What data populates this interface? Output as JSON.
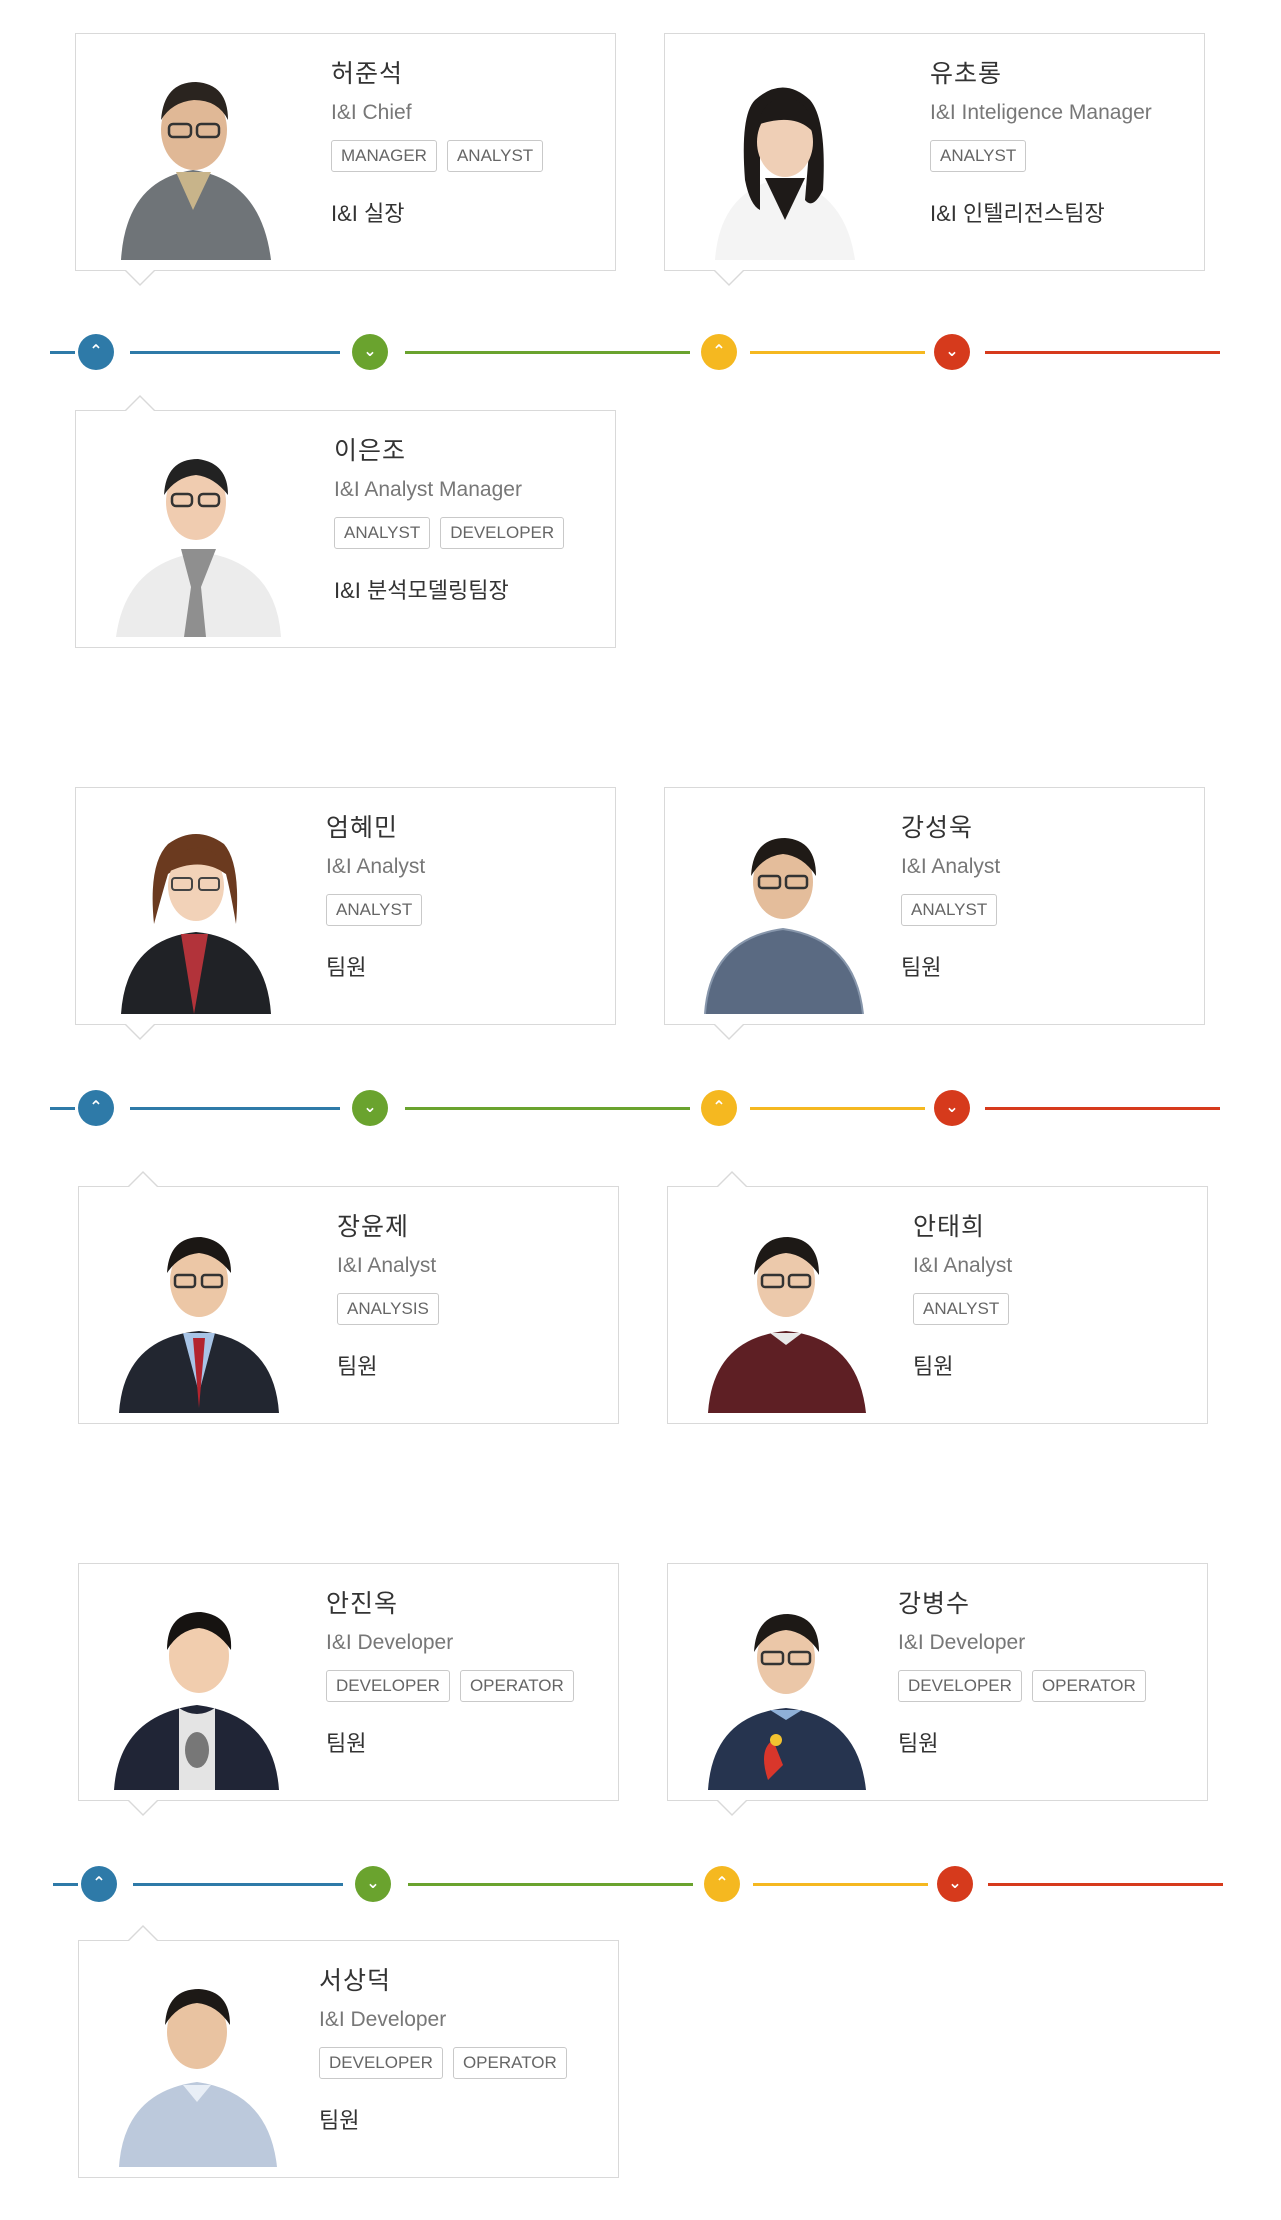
{
  "colors": {
    "blue": "#2e7aa8",
    "green": "#6aa32e",
    "yellow": "#f5b820",
    "red": "#d63a1c"
  },
  "timeline_icons": [
    "chevron-up-icon",
    "chevron-down-icon",
    "chevron-up-icon",
    "chevron-down-icon"
  ],
  "members": [
    {
      "name": "허준석",
      "title": "I&I Chief",
      "tags": [
        "MANAGER",
        "ANALYST"
      ],
      "role": "I&I 실장"
    },
    {
      "name": "유초롱",
      "title": "I&I Inteligence Manager",
      "tags": [
        "ANALYST"
      ],
      "role": "I&I 인텔리전스팀장"
    },
    {
      "name": "이은조",
      "title": "I&I Analyst Manager",
      "tags": [
        "ANALYST",
        "DEVELOPER"
      ],
      "role": "I&I 분석모델링팀장"
    },
    {
      "name": "엄혜민",
      "title": "I&I Analyst",
      "tags": [
        "ANALYST"
      ],
      "role": "팀원"
    },
    {
      "name": "강성욱",
      "title": "I&I Analyst",
      "tags": [
        "ANALYST"
      ],
      "role": "팀원"
    },
    {
      "name": "장윤제",
      "title": "I&I Analyst",
      "tags": [
        "ANALYSIS"
      ],
      "role": "팀원"
    },
    {
      "name": "안태희",
      "title": "I&I Analyst",
      "tags": [
        "ANALYST"
      ],
      "role": "팀원"
    },
    {
      "name": "안진옥",
      "title": "I&I Developer",
      "tags": [
        "DEVELOPER",
        "OPERATOR"
      ],
      "role": "팀원"
    },
    {
      "name": "강병수",
      "title": "I&I Developer",
      "tags": [
        "DEVELOPER",
        "OPERATOR"
      ],
      "role": "팀원"
    },
    {
      "name": "서상덕",
      "title": "I&I Developer",
      "tags": [
        "DEVELOPER",
        "OPERATOR"
      ],
      "role": "팀원"
    }
  ]
}
